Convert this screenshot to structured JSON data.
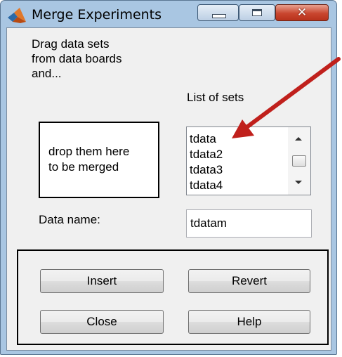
{
  "window": {
    "title": "Merge Experiments",
    "close_glyph": "✕"
  },
  "instructions": {
    "line1": "Drag data sets",
    "line2": "from data boards",
    "line3": "and..."
  },
  "drop_zone": {
    "line1": "drop them here",
    "line2": "to be merged"
  },
  "sets": {
    "label": "List of sets",
    "items": [
      "tdata",
      "tdata2",
      "tdata3",
      "tdata4"
    ]
  },
  "data_name": {
    "label": "Data name:",
    "value": "tdatam"
  },
  "buttons": {
    "insert": "Insert",
    "revert": "Revert",
    "close": "Close",
    "help": "Help"
  },
  "icons": {
    "app": "matlab-logo-icon",
    "minimize": "minimize-icon",
    "maximize": "maximize-icon",
    "close": "close-icon",
    "scroll_up": "scroll-up-arrow-icon",
    "scroll_down": "scroll-down-arrow-icon",
    "annotation": "red-arrow-annotation"
  },
  "colors": {
    "titlebar": "#a9c6e2",
    "close_button": "#c9462f",
    "annotation_arrow": "#c0201c"
  }
}
